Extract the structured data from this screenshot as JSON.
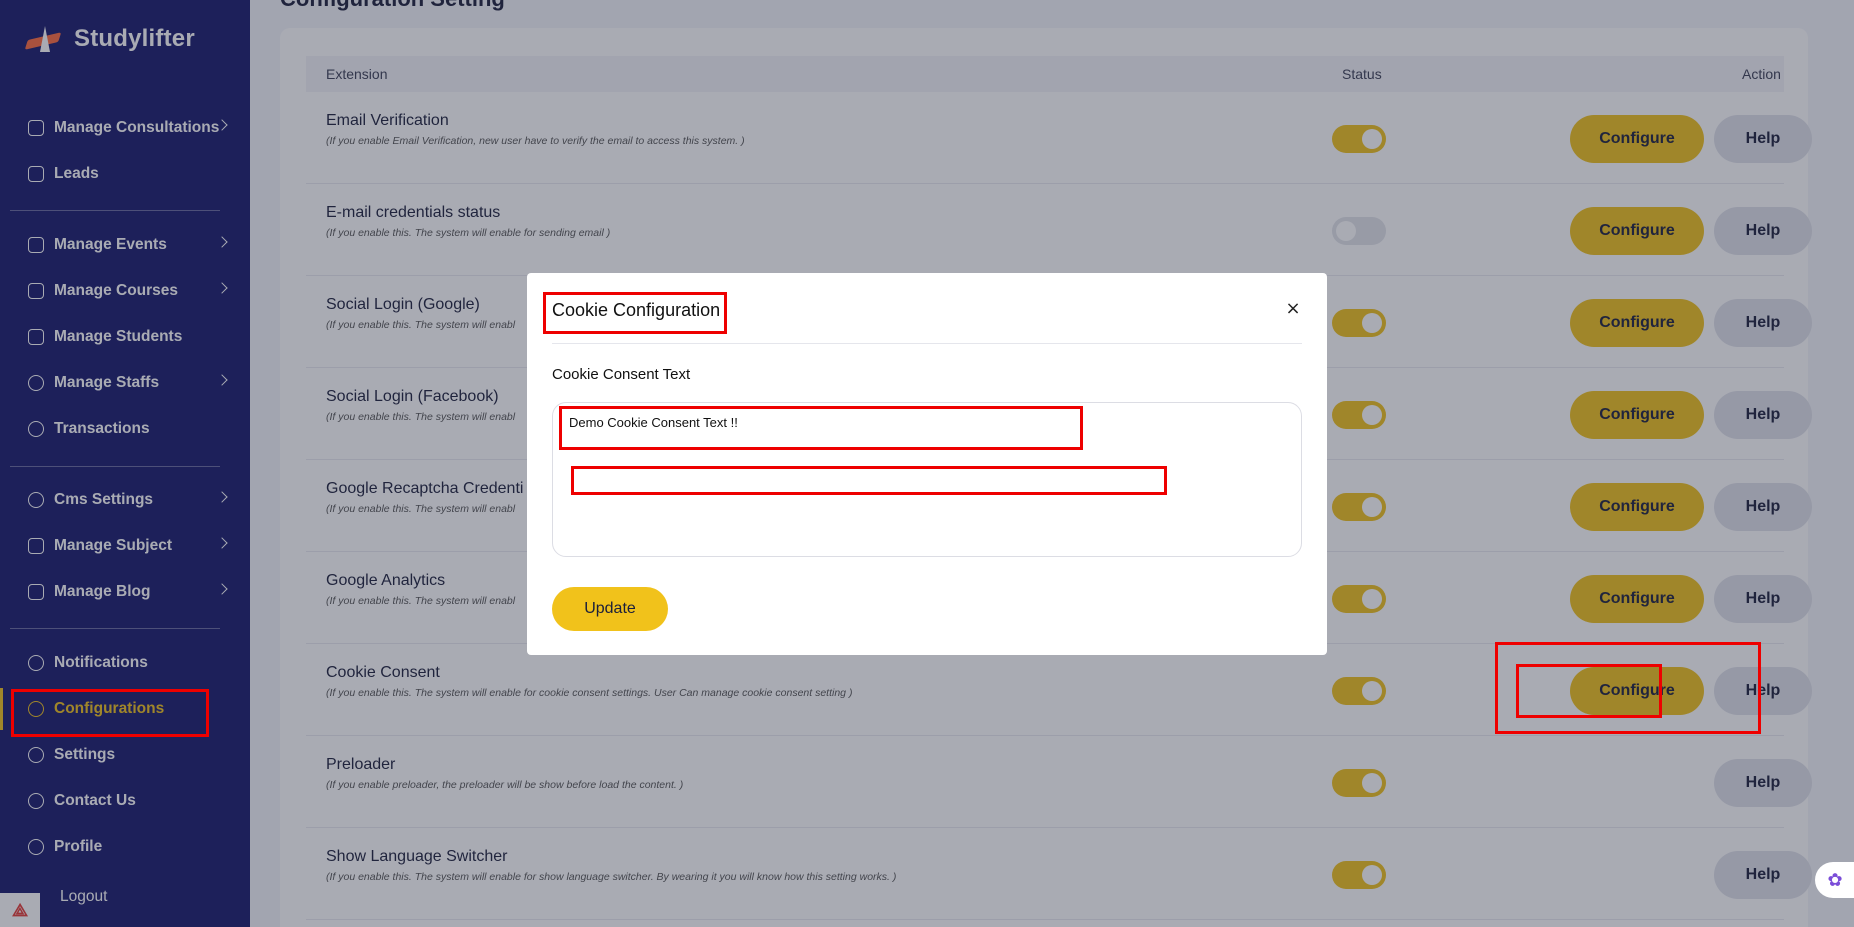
{
  "brand": {
    "name": "Studylifter"
  },
  "sidebar": {
    "items": [
      {
        "label": "Manage Consultations",
        "icon": "consultation-icon",
        "has_submenu": true
      },
      {
        "label": "Leads",
        "icon": "leads-icon",
        "has_submenu": false
      },
      {
        "label": "Manage Events",
        "icon": "calendar-icon",
        "has_submenu": true
      },
      {
        "label": "Manage Courses",
        "icon": "courses-icon",
        "has_submenu": true
      },
      {
        "label": "Manage Students",
        "icon": "students-icon",
        "has_submenu": false
      },
      {
        "label": "Manage Staffs",
        "icon": "staffs-icon",
        "has_submenu": true
      },
      {
        "label": "Transactions",
        "icon": "transactions-icon",
        "has_submenu": false
      },
      {
        "label": "Cms Settings",
        "icon": "cms-settings-icon",
        "has_submenu": true
      },
      {
        "label": "Manage Subject",
        "icon": "book-icon",
        "has_submenu": true
      },
      {
        "label": "Manage Blog",
        "icon": "blog-icon",
        "has_submenu": true
      },
      {
        "label": "Notifications",
        "icon": "bell-icon",
        "has_submenu": false
      },
      {
        "label": "Configurations",
        "icon": "configurations-icon",
        "has_submenu": false,
        "active": true
      },
      {
        "label": "Settings",
        "icon": "gear-icon",
        "has_submenu": false
      },
      {
        "label": "Contact Us",
        "icon": "contact-icon",
        "has_submenu": false
      },
      {
        "label": "Profile",
        "icon": "user-icon",
        "has_submenu": false
      },
      {
        "label": "Logout",
        "icon": "logout-icon",
        "has_submenu": false
      }
    ]
  },
  "page": {
    "heading": "Configuration Setting"
  },
  "table": {
    "headers": {
      "extension": "Extension",
      "status": "Status",
      "action": "Action"
    },
    "rows": [
      {
        "title": "Email Verification",
        "desc": "(If you enable Email Verification, new user have to verify the email to access this system. )",
        "enabled": true,
        "configure": true
      },
      {
        "title": "E-mail credentials status",
        "desc": "(If you enable this. The system will enable for sending email )",
        "enabled": false,
        "configure": true
      },
      {
        "title": "Social Login (Google)",
        "desc": "(If you enable this. The system will enabl",
        "enabled": true,
        "configure": true
      },
      {
        "title": "Social Login (Facebook)",
        "desc": "(If you enable this. The system will enabl",
        "enabled": true,
        "configure": true
      },
      {
        "title": "Google Recaptcha Credenti",
        "desc": "(If you enable this. The system will enabl",
        "enabled": true,
        "configure": true
      },
      {
        "title": "Google Analytics",
        "desc": "(If you enable this. The system will enabl",
        "enabled": true,
        "configure": true
      },
      {
        "title": "Cookie Consent",
        "desc": "(If you enable this. The system will enable for cookie consent settings. User Can manage cookie consent setting )",
        "enabled": true,
        "configure": true
      },
      {
        "title": "Preloader",
        "desc": "(If you enable preloader, the preloader will be show before load the content. )",
        "enabled": true,
        "configure": false
      },
      {
        "title": "Show Language Switcher",
        "desc": "(If you enable this. The system will enable for show language switcher. By wearing it you will know how this setting works. )",
        "enabled": true,
        "configure": false
      }
    ],
    "configure_label": "Configure",
    "help_label": "Help"
  },
  "modal": {
    "title": "Cookie Configuration",
    "close_glyph": "×",
    "field_label": "Cookie Consent Text",
    "field_value": "Demo Cookie Consent Text !!",
    "update_label": "Update"
  },
  "colors": {
    "sidebar_bg": "#16186b",
    "accent": "#f1c21b",
    "highlight": "#ee0000"
  }
}
